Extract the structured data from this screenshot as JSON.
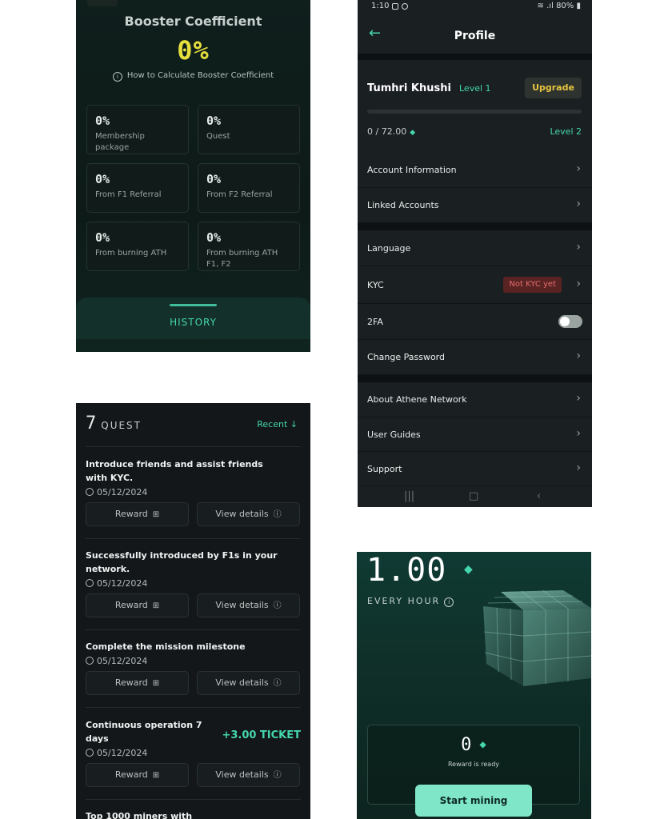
{
  "booster": {
    "title": "Booster Coefficient",
    "value": "0%",
    "how_to": "How to Calculate Booster Coefficient",
    "info_icon": "info-icon",
    "stats": [
      {
        "value": "0%",
        "label": "Membership package"
      },
      {
        "value": "0%",
        "label": "Quest"
      },
      {
        "value": "0%",
        "label": "From F1 Referral"
      },
      {
        "value": "0%",
        "label": "From F2 Referral"
      },
      {
        "value": "0%",
        "label": "From burning ATH"
      },
      {
        "value": "0%",
        "label": "From burning ATH F1, F2"
      }
    ],
    "history_label": "HISTORY"
  },
  "profile": {
    "status_bar": {
      "time": "1:10",
      "battery": "80%"
    },
    "title": "Profile",
    "back_icon": "back-arrow-icon",
    "user": {
      "name": "Tumhri Khushi",
      "level": "Level 1",
      "upgrade_label": "Upgrade",
      "progress_text": "0 / 72.00",
      "progress_fraction": 0.0,
      "next_level": "Level 2"
    },
    "menu": {
      "account_information": "Account Information",
      "linked_accounts": "Linked Accounts",
      "language": "Language",
      "kyc": "KYC",
      "kyc_status": "Not KYC yet",
      "twofa": "2FA",
      "twofa_enabled": false,
      "change_password": "Change Password",
      "about": "About Athene Network",
      "user_guides": "User Guides",
      "support": "Support"
    }
  },
  "quest": {
    "count": "7",
    "heading": "QUEST",
    "sort_label": "Recent",
    "reward_label": "Reward",
    "details_label": "View details",
    "items": [
      {
        "title": "Introduce friends and assist friends with KYC.",
        "date": "05/12/2024"
      },
      {
        "title": "Successfully introduced by F1s in your network.",
        "date": "05/12/2024"
      },
      {
        "title": "Complete the mission milestone",
        "date": "05/12/2024"
      },
      {
        "title": "Continuous operation 7 days",
        "date": "05/12/2024",
        "bonus": "+3.00 TICKET"
      }
    ],
    "partial_item": "Top 1000 miners with"
  },
  "mining": {
    "rate": "1.00",
    "per_label": "EVERY HOUR",
    "balance": "0",
    "status": "Reward is ready",
    "start_label": "Start mining"
  },
  "colors": {
    "accent": "#45d6ad",
    "booster_value": "#e7df3e",
    "kyc_badge": "#5a2323",
    "upgrade_text": "#e7c53e"
  }
}
